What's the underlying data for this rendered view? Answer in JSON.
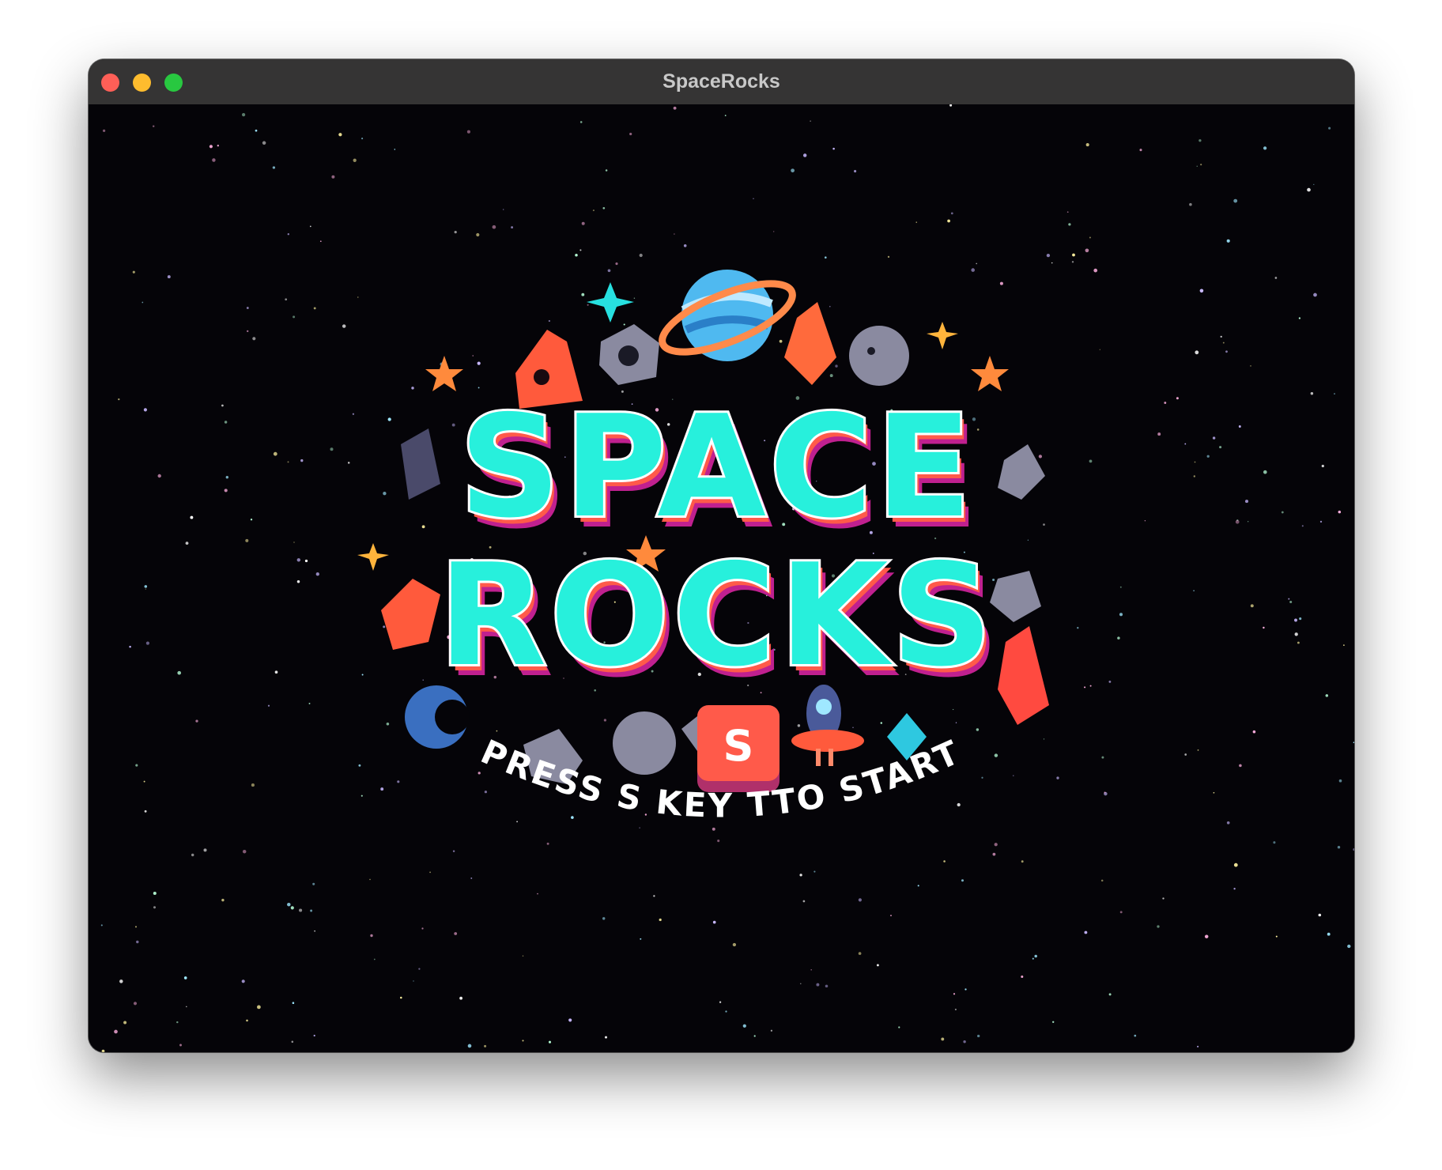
{
  "window": {
    "title": "SpaceRocks",
    "controls": [
      "close",
      "minimize",
      "zoom"
    ]
  },
  "game": {
    "title_line1": "SPACE",
    "title_line2": "ROCKS",
    "start_key": "S",
    "start_prompt": "PRESS S KEY TTO START"
  },
  "colors": {
    "background": "#050408",
    "title_fill": "#27f0dc",
    "title_shadow": "#c0208f",
    "rock_orange": "#ff5a3c",
    "rock_gray": "#8a8aa0"
  }
}
